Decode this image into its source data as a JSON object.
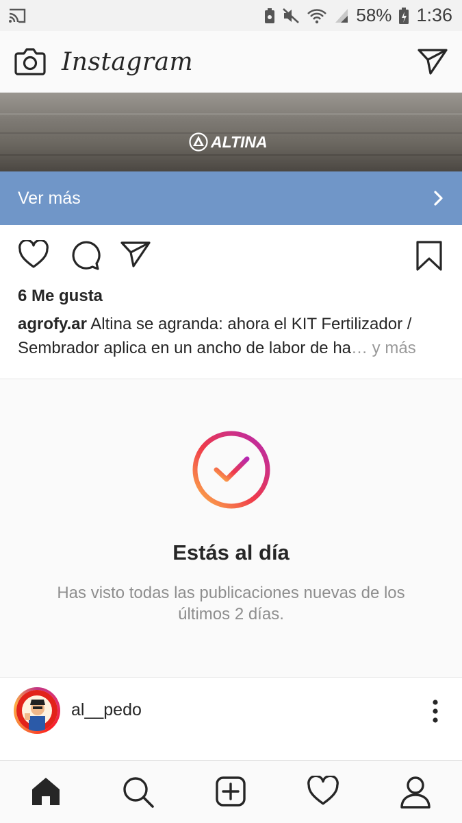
{
  "status_bar": {
    "icons": [
      "cast-icon",
      "battery-saver-icon",
      "mute-icon",
      "wifi-icon",
      "signal-icon",
      "battery-icon"
    ],
    "battery_percent": "58%",
    "time": "1:36"
  },
  "header": {
    "title": "Instagram",
    "icons": [
      "camera-icon",
      "direct-message-icon"
    ]
  },
  "ad": {
    "brand": "ALTINA",
    "cta_label": "Ver más"
  },
  "post": {
    "likes": "6 Me gusta",
    "username": "agrofy.ar",
    "caption": "Altina se agranda: ahora el KIT Fertilizador / Sembrador aplica en un ancho de labor de ha",
    "more": "… y más",
    "action_icons": [
      "heart-icon",
      "comment-icon",
      "share-icon",
      "bookmark-icon"
    ]
  },
  "caught_up": {
    "title": "Estás al día",
    "message": "Has visto todas las publicaciones nuevas de los últimos 2 días."
  },
  "next_post": {
    "username": "al__pedo"
  },
  "nav": {
    "items": [
      "home-icon",
      "search-icon",
      "new-post-icon",
      "activity-icon",
      "profile-icon"
    ]
  },
  "colors": {
    "cta_bar": "#7096c8",
    "text": "#262626",
    "muted": "#8e8e8e"
  }
}
